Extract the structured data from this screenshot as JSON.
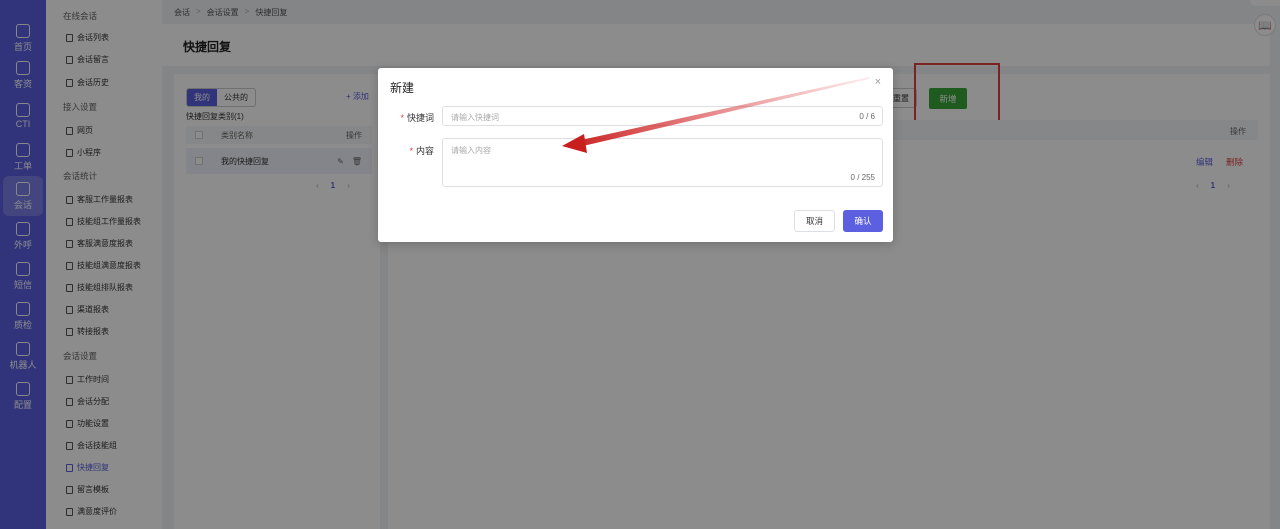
{
  "rail": [
    {
      "label": "首页",
      "icon": "home-icon"
    },
    {
      "label": "客资",
      "icon": "customer-icon"
    },
    {
      "label": "CTI",
      "icon": "cti-icon"
    },
    {
      "label": "工单",
      "icon": "ticket-icon"
    },
    {
      "label": "会话",
      "icon": "chat-icon",
      "active": true
    },
    {
      "label": "外呼",
      "icon": "phone-icon"
    },
    {
      "label": "短信",
      "icon": "sms-icon"
    },
    {
      "label": "质检",
      "icon": "quality-icon"
    },
    {
      "label": "机器人",
      "icon": "robot-icon"
    },
    {
      "label": "配置",
      "icon": "settings-icon"
    }
  ],
  "subnav": {
    "groups": [
      {
        "title": "在线会话",
        "items": [
          "会话列表",
          "会话留言",
          "会话历史"
        ]
      },
      {
        "title": "接入设置",
        "items": [
          "网页",
          "小程序"
        ]
      },
      {
        "title": "会话统计",
        "items": [
          "客服工作量报表",
          "技能组工作量报表",
          "客服满意度报表",
          "技能组满意度报表",
          "技能组排队报表",
          "渠道报表",
          "转接报表"
        ]
      },
      {
        "title": "会话设置",
        "items": [
          "工作时间",
          "会话分配",
          "功能设置",
          "会话技能组",
          "快捷回复",
          "留言模板",
          "满意度评价"
        ]
      }
    ],
    "active_item": "快捷回复"
  },
  "breadcrumb": [
    "会话",
    "会话设置",
    "快捷回复"
  ],
  "page_title": "快捷回复",
  "left_panel": {
    "tabs": [
      "我的",
      "公共的"
    ],
    "active_tab": "我的",
    "add_label": "+ 添加",
    "category_count": "快捷回复类别(1)",
    "col_name": "类别名称",
    "col_action": "操作",
    "rows": [
      {
        "name": "我的快捷回复"
      }
    ],
    "pager_current": "1"
  },
  "right_panel": {
    "reset_label": "重置",
    "new_label": "新增",
    "col_action": "操作",
    "edit_label": "编辑",
    "delete_label": "删除",
    "pager_current": "1"
  },
  "modal": {
    "title": "新建",
    "close": "×",
    "shortcut_label": "快捷词",
    "shortcut_placeholder": "请输入快捷词",
    "shortcut_count": "0 / 6",
    "content_label": "内容",
    "content_placeholder": "请输入内容",
    "content_count": "0 / 255",
    "cancel_label": "取消",
    "confirm_label": "确认"
  },
  "colors": {
    "accent": "#5b5fe0",
    "new_button": "#3aa63a",
    "annotation": "#e04040"
  }
}
